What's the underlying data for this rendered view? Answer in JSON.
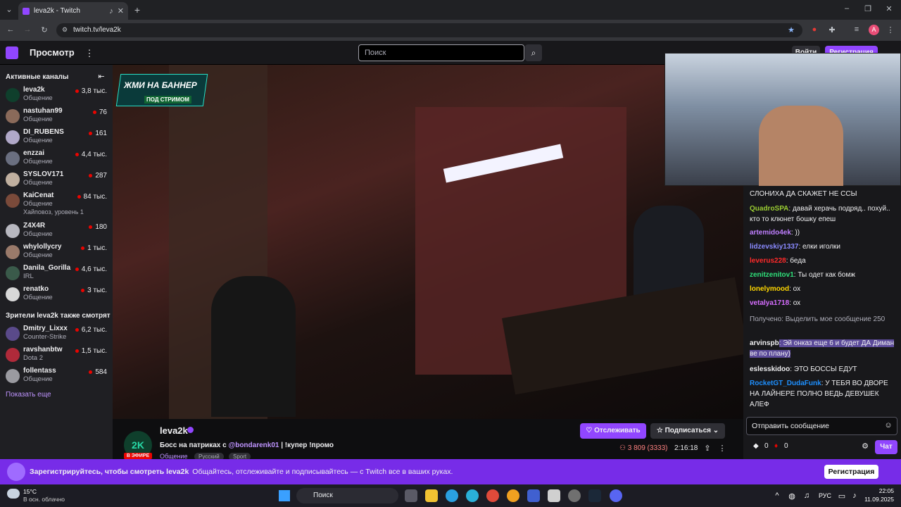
{
  "browser": {
    "tab_title": "leva2k - Twitch",
    "url": "twitch.tv/leva2k",
    "profile_initial": "A"
  },
  "topnav": {
    "browse": "Просмотр",
    "search_placeholder": "Поиск",
    "login": "Войти",
    "register": "Регистрация"
  },
  "sidebar": {
    "active_header": "Активные каналы",
    "channels": [
      {
        "name": "leva2k",
        "category": "Общение",
        "viewers": "3,8 тыс.",
        "color": "#0f3f2c"
      },
      {
        "name": "nastuhan99",
        "category": "Общение",
        "viewers": "76",
        "color": "#8a6a5a"
      },
      {
        "name": "DI_RUBENS",
        "category": "Общение",
        "viewers": "161",
        "color": "#b0a8c8"
      },
      {
        "name": "enzzai",
        "category": "Общение",
        "viewers": "4,4 тыс.",
        "color": "#6a6f80"
      },
      {
        "name": "SYSLOV171",
        "category": "Общение",
        "viewers": "287",
        "color": "#c0b0a0"
      },
      {
        "name": "KaiCenat",
        "category": "Общение",
        "viewers": "84 тыс.",
        "extra": "Хайповоз, уровень 1",
        "color": "#7a4a3a"
      },
      {
        "name": "Z4X4R",
        "category": "Общение",
        "viewers": "180",
        "color": "#b8b8c0"
      },
      {
        "name": "whylollycry",
        "category": "Общение",
        "viewers": "1 тыс.",
        "color": "#9a7a6a"
      },
      {
        "name": "Danila_Gorilla",
        "category": "IRL",
        "viewers": "4,6 тыс.",
        "color": "#3a5a4a"
      },
      {
        "name": "renatko",
        "category": "Общение",
        "viewers": "3 тыс.",
        "color": "#d8d8d8"
      }
    ],
    "also_header": "Зрители leva2k также смотрят",
    "also": [
      {
        "name": "Dmitry_Lixxx",
        "category": "Counter-Strike",
        "viewers": "6,2 тыс.",
        "color": "#5a4a8a"
      },
      {
        "name": "ravshanbtw",
        "category": "Dota 2",
        "viewers": "1,5 тыс.",
        "color": "#b02a3a"
      },
      {
        "name": "follentass",
        "category": "Общение",
        "viewers": "584",
        "color": "#9a9aa0"
      }
    ],
    "show_more": "Показать еще"
  },
  "banner": {
    "text": "ЖМИ НА БАННЕР",
    "sub": "ПОД СТРИМОМ"
  },
  "stream": {
    "channel": "leva2k",
    "title_pre": "Босс на патриках с ",
    "mention": "@bondarenk01",
    "title_post": " | !купер !промо",
    "category": "Общение",
    "tags": [
      "Русский",
      "Sport"
    ],
    "live": "В ЭФИРЕ",
    "viewers": "3 809 (3333)",
    "uptime": "2:16:18",
    "follow": "Отслеживать",
    "subscribe": "Подписаться"
  },
  "chat": {
    "messages": [
      {
        "user": "",
        "text": "СЛОНИХА ДА СКАЖЕТ НЕ ССЫ",
        "color": "#efeff1"
      },
      {
        "user": "QuadroSPA",
        "text": ": давай херачь подряд.. похуй.. кто то клюнет бошку епеш",
        "color": "#9acd32"
      },
      {
        "user": "artemido4ek",
        "text": ": ))",
        "color": "#bf7fff"
      },
      {
        "user": "lidzevskiy1337",
        "text": ": елки иголки",
        "color": "#8a8aff"
      },
      {
        "user": "leverus228",
        "text": ": беда",
        "color": "#ff2a2a"
      },
      {
        "user": "zenitzenitov1",
        "text": ": Ты одет как бомж",
        "color": "#2fe07a"
      },
      {
        "user": "lonelymood",
        "text": ": ох",
        "color": "#ffd700"
      },
      {
        "user": "vetalya1718",
        "text": ": ох",
        "color": "#d66eff"
      },
      {
        "user": "",
        "text": "Получено: Выделить мое сообщение  250",
        "color": "#adadb8"
      },
      {
        "user": "arvinspb",
        "text": ": Эй онказ еще 6 и будет ДА Диман ве по плану)",
        "color": "#efeff1"
      },
      {
        "user": "eslesskidoo",
        "text": ": ЭТО БОССЫ ЕДУТ",
        "color": "#efeff1"
      },
      {
        "user": "RocketGT_DudaFunk",
        "text": ": У ТЕБЯ ВО ДВОРЕ НА ЛАЙНЕРЕ ПОЛНО ВЕДЬ ДЕВУШЕК АЛЕФ",
        "color": "#1e90ff"
      }
    ],
    "input_placeholder": "Отправить сообщение",
    "points_a": "0",
    "points_b": "0",
    "chat_button": "Чат"
  },
  "promo": {
    "bold": "Зарегистрируйтесь, чтобы смотреть leva2k",
    "text": "Общайтесь, отслеживайте и подписывайтесь — с Twitch все в ваших руках.",
    "button": "Регистрация"
  },
  "taskbar": {
    "temp": "15°C",
    "weather": "В осн. облачно",
    "search": "Поиск",
    "lang": "РУС",
    "time": "22:05",
    "date": "11.09.2025"
  }
}
